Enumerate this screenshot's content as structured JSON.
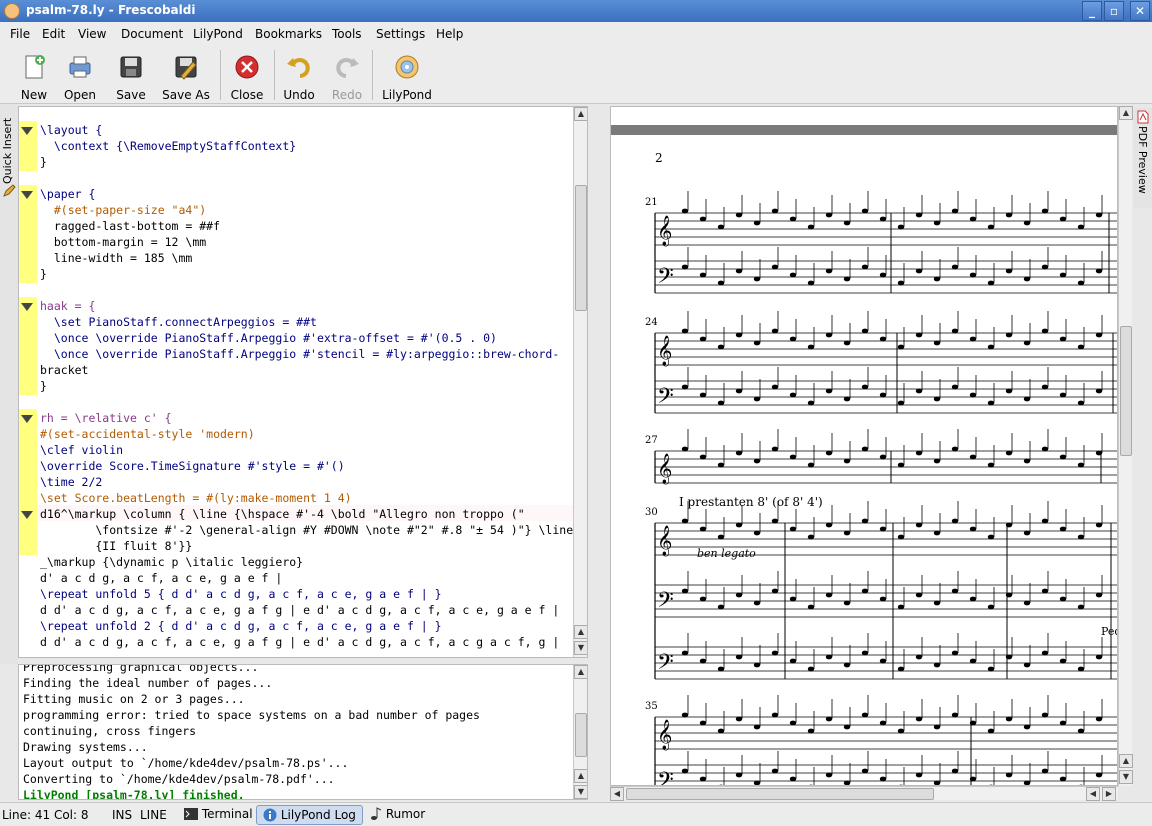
{
  "window": {
    "title": "psalm-78.ly - Frescobaldi"
  },
  "menu": [
    "File",
    "Edit",
    "View",
    "Document",
    "LilyPond",
    "Bookmarks",
    "Tools",
    "Settings",
    "Help"
  ],
  "toolbar": {
    "new": "New",
    "open": "Open",
    "save": "Save",
    "save_as": "Save As",
    "close": "Close",
    "undo": "Undo",
    "redo": "Redo",
    "lilypond": "LilyPond"
  },
  "sidetab": {
    "quick_insert": "Quick Insert"
  },
  "pdf_tab": "PDF Preview",
  "editor": {
    "lines": [
      "\\layout {",
      "  \\context {\\RemoveEmptyStaffContext}",
      "}",
      "",
      "\\paper {",
      "  #(set-paper-size \"a4\")",
      "  ragged-last-bottom = ##f",
      "  bottom-margin = 12 \\mm",
      "  line-width = 185 \\mm",
      "}",
      "",
      "haak = {",
      "  \\set PianoStaff.connectArpeggios = ##t",
      "  \\once \\override PianoStaff.Arpeggio #'extra-offset = #'(0.5 . 0)",
      "  \\once \\override PianoStaff.Arpeggio #'stencil = #ly:arpeggio::brew-chord-",
      "bracket",
      "}",
      "",
      "rh = \\relative c' {",
      "#(set-accidental-style 'modern)",
      "\\clef violin",
      "\\override Score.TimeSignature #'style = #'()",
      "\\time 2/2",
      "\\set Score.beatLength = #(ly:make-moment 1 4)",
      "d16^\\markup \\column { \\line {\\hspace #'-4 \\bold \"Allegro non troppo (\"",
      "        \\fontsize #'-2 \\general-align #Y #DOWN \\note #\"2\" #.8 \"± 54 )\"} \\line",
      "        {II fluit 8'}}",
      "_\\markup {\\dynamic p \\italic leggiero}",
      "d' a c d g, a c f, a c e, g a e f |",
      "\\repeat unfold 5 { d d' a c d g, a c f, a c e, g a e f | }",
      "d d' a c d g, a c f, a c e, g a f g | e d' a c d g, a c f, a c e, g a e f |",
      "\\repeat unfold 2 { d d' a c d g, a c f, a c e, g a e f | }",
      "d d' a c d g, a c f, a c e, g a f g | e d' a c d g, a c f, a c g a c f, g |"
    ]
  },
  "log": {
    "lines": [
      "Preprocessing graphical objects...",
      "Finding the ideal number of pages...",
      "Fitting music on 2 or 3 pages...",
      "programming error: tried to space systems on a bad number of pages",
      "continuing, cross fingers",
      "Drawing systems...",
      "Layout output to `/home/kde4dev/psalm-78.ps'...",
      "Converting to `/home/kde4dev/psalm-78.pdf'...",
      "LilyPond [psalm-78.ly] finished."
    ]
  },
  "score": {
    "page_number": "2",
    "measures": [
      "21",
      "24",
      "27",
      "30",
      "35"
    ],
    "registration": "I prestanten 8' (of 8' 4')",
    "expression": "ben legato",
    "pedal": "Ped"
  },
  "status": {
    "position": "Line: 41 Col: 8",
    "ins": "INS",
    "line_mode": "LINE",
    "terminal": "Terminal",
    "lilypond_log": "LilyPond Log",
    "rumor": "Rumor"
  }
}
